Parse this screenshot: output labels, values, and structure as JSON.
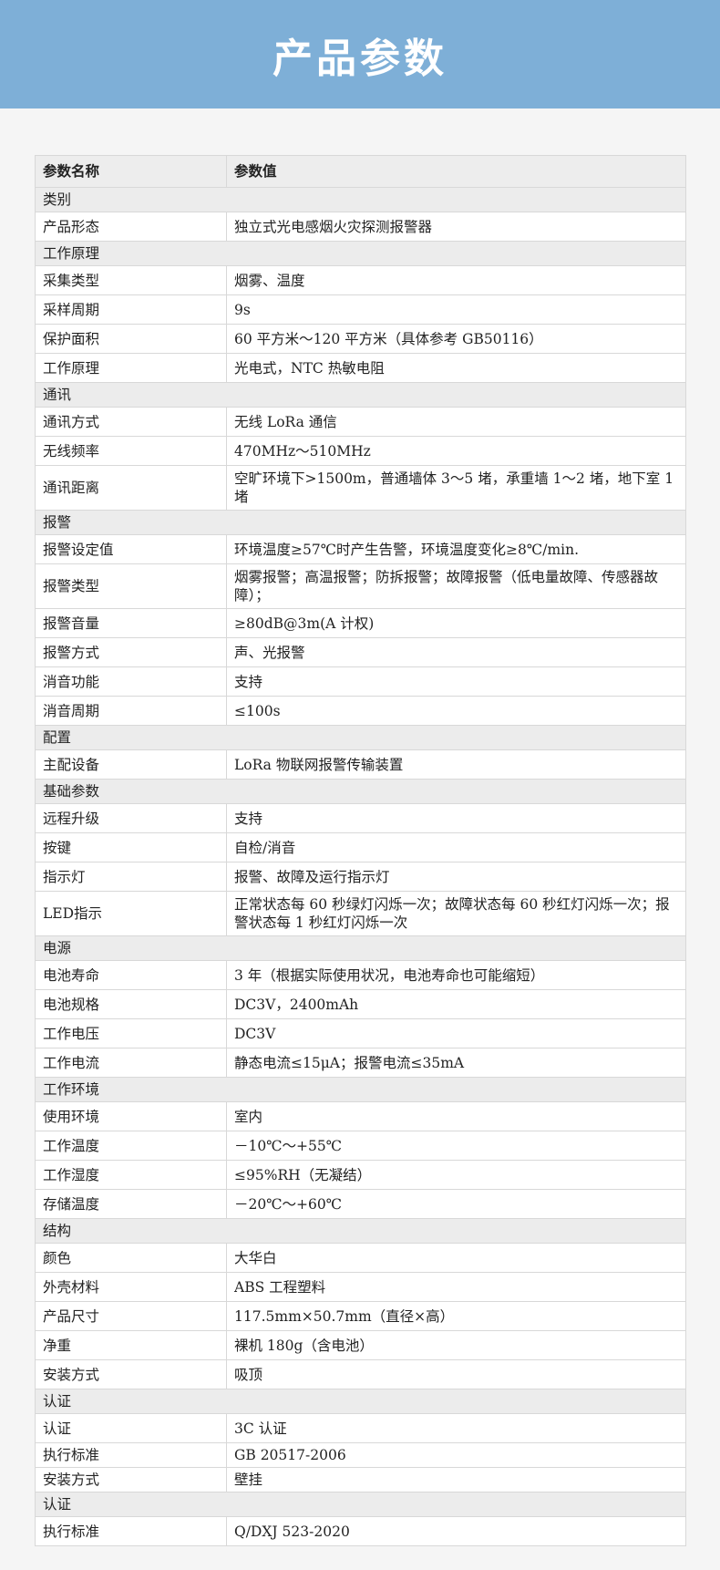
{
  "banner": {
    "title": "产品参数"
  },
  "table": {
    "headers": [
      "参数名称",
      "参数值"
    ],
    "rows": [
      {
        "type": "section",
        "label": "类别"
      },
      {
        "type": "row",
        "name": "产品形态",
        "value": "独立式光电感烟火灾探测报警器"
      },
      {
        "type": "section",
        "label": "工作原理"
      },
      {
        "type": "row",
        "name": "采集类型",
        "value": "烟雾、温度"
      },
      {
        "type": "row",
        "name": "采样周期",
        "value": "9s"
      },
      {
        "type": "row",
        "name": "保护面积",
        "value": "60 平方米～120 平方米（具体参考 GB50116）"
      },
      {
        "type": "row",
        "name": "工作原理",
        "value": "光电式，NTC 热敏电阻"
      },
      {
        "type": "section",
        "label": "通讯"
      },
      {
        "type": "row",
        "name": "通讯方式",
        "value": "无线 LoRa 通信"
      },
      {
        "type": "row",
        "name": "无线频率",
        "value": "470MHz～510MHz"
      },
      {
        "type": "row",
        "name": "通讯距离",
        "value": "空旷环境下>1500m，普通墙体 3～5 堵，承重墙 1～2 堵，地下室 1 堵",
        "tall": true
      },
      {
        "type": "section",
        "label": "报警"
      },
      {
        "type": "row",
        "name": "报警设定值",
        "value": "环境温度≥57℃时产生告警，环境温度变化≥8℃/min."
      },
      {
        "type": "row",
        "name": "报警类型",
        "value": "烟雾报警；高温报警；防拆报警；故障报警（低电量故障、传感器故障）；",
        "tall": true
      },
      {
        "type": "row",
        "name": "报警音量",
        "value": "≥80dB@3m(A 计权)"
      },
      {
        "type": "row",
        "name": "报警方式",
        "value": "声、光报警"
      },
      {
        "type": "row",
        "name": "消音功能",
        "value": "支持"
      },
      {
        "type": "row",
        "name": "消音周期",
        "value": "≤100s"
      },
      {
        "type": "section",
        "label": "配置"
      },
      {
        "type": "row",
        "name": "主配设备",
        "value": "LoRa 物联网报警传输装置"
      },
      {
        "type": "section",
        "label": "基础参数"
      },
      {
        "type": "row",
        "name": "远程升级",
        "value": "支持"
      },
      {
        "type": "row",
        "name": "按键",
        "value": "自检/消音"
      },
      {
        "type": "row",
        "name": "指示灯",
        "value": "报警、故障及运行指示灯"
      },
      {
        "type": "row",
        "name": "LED指示",
        "value": "正常状态每 60 秒绿灯闪烁一次；故障状态每 60 秒红灯闪烁一次；报警状态每 1 秒红灯闪烁一次",
        "tall": true
      },
      {
        "type": "section",
        "label": "电源"
      },
      {
        "type": "row",
        "name": "电池寿命",
        "value": "3 年（根据实际使用状况，电池寿命也可能缩短）"
      },
      {
        "type": "row",
        "name": "电池规格",
        "value": "DC3V，2400mAh"
      },
      {
        "type": "row",
        "name": "工作电压",
        "value": "DC3V"
      },
      {
        "type": "row",
        "name": "工作电流",
        "value": "静态电流≤15μA；报警电流≤35mA"
      },
      {
        "type": "section",
        "label": "工作环境"
      },
      {
        "type": "row",
        "name": "使用环境",
        "value": "室内"
      },
      {
        "type": "row",
        "name": "工作温度",
        "value": "－10℃～+55℃"
      },
      {
        "type": "row",
        "name": "工作湿度",
        "value": "≤95%RH（无凝结）"
      },
      {
        "type": "row",
        "name": "存储温度",
        "value": "－20℃～+60℃"
      },
      {
        "type": "section",
        "label": "结构"
      },
      {
        "type": "row",
        "name": "颜色",
        "value": "大华白"
      },
      {
        "type": "row",
        "name": "外壳材料",
        "value": "ABS 工程塑料"
      },
      {
        "type": "row",
        "name": "产品尺寸",
        "value": "117.5mm×50.7mm（直径×高）"
      },
      {
        "type": "row",
        "name": "净重",
        "value": "裸机 180g（含电池）"
      },
      {
        "type": "row",
        "name": "安装方式",
        "value": "吸顶"
      },
      {
        "type": "section",
        "label": "认证"
      },
      {
        "type": "row",
        "name": "认证",
        "value": "3C 认证"
      },
      {
        "type": "row",
        "name": "执行标准",
        "value": "GB 20517-2006",
        "short": true
      },
      {
        "type": "row",
        "name": "安装方式",
        "value": "壁挂",
        "short": true
      },
      {
        "type": "section",
        "label": "认证"
      },
      {
        "type": "row",
        "name": "执行标准",
        "value": "Q/DXJ 523-2020"
      }
    ]
  }
}
